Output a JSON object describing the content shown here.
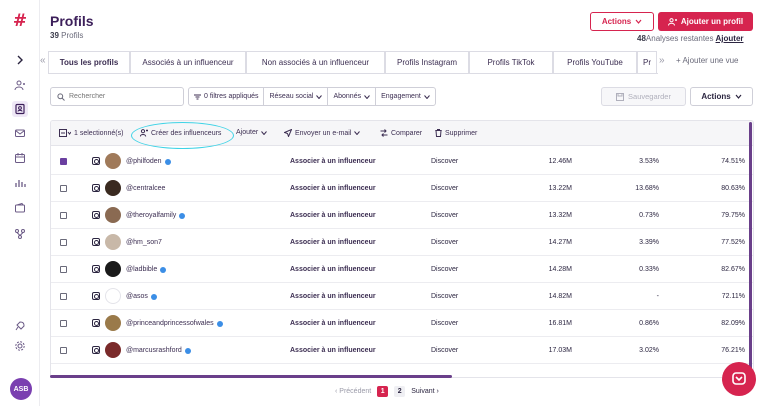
{
  "header": {
    "title": "Profils",
    "profile_count": "39",
    "profile_label": "Profils",
    "actions_label": "Actions",
    "add_label": "Ajouter un profil",
    "remaining_count": "48",
    "remaining_label": "Analyses restantes",
    "add_link": "Ajouter"
  },
  "tabs": [
    {
      "label": "Tous les profils",
      "active": true
    },
    {
      "label": "Associés à un influenceur"
    },
    {
      "label": "Non associés à un influenceur"
    },
    {
      "label": "Profils Instagram"
    },
    {
      "label": "Profils TikTok"
    },
    {
      "label": "Profils YouTube"
    },
    {
      "label": "Pr"
    }
  ],
  "add_view_label": "Ajouter une vue",
  "filters": {
    "search_placeholder": "Rechercher",
    "applied": "0 filtres appliqués",
    "network": "Réseau social",
    "followers": "Abonnés",
    "engagement": "Engagement",
    "save": "Sauvegarder",
    "actions": "Actions"
  },
  "toolbar": {
    "selected": "1 selectionné(s)",
    "create": "Créer des influenceurs",
    "add": "Ajouter",
    "email": "Envoyer un e-mail",
    "compare": "Comparer",
    "delete": "Supprimer"
  },
  "rows": [
    {
      "handle": "@philfoden",
      "verified": true,
      "checked": true,
      "assoc": "Associer à un influenceur",
      "source": "Discover",
      "followers": "12.46M",
      "engagement": "3.53%",
      "last": "74.51%",
      "pic": "#a07a5a"
    },
    {
      "handle": "@centralcee",
      "verified": false,
      "checked": false,
      "assoc": "Associer à un influenceur",
      "source": "Discover",
      "followers": "13.22M",
      "engagement": "13.68%",
      "last": "80.63%",
      "pic": "#3a2a20"
    },
    {
      "handle": "@theroyalfamily",
      "verified": true,
      "checked": false,
      "assoc": "Associer à un influenceur",
      "source": "Discover",
      "followers": "13.32M",
      "engagement": "0.73%",
      "last": "79.75%",
      "pic": "#8a6a52"
    },
    {
      "handle": "@hm_son7",
      "verified": false,
      "checked": false,
      "assoc": "Associer à un influenceur",
      "source": "Discover",
      "followers": "14.27M",
      "engagement": "3.39%",
      "last": "77.52%",
      "pic": "#c8b8a8"
    },
    {
      "handle": "@ladbible",
      "verified": true,
      "checked": false,
      "assoc": "Associer à un influenceur",
      "source": "Discover",
      "followers": "14.28M",
      "engagement": "0.33%",
      "last": "82.67%",
      "pic": "#1a1a1a"
    },
    {
      "handle": "@asos",
      "verified": true,
      "checked": false,
      "assoc": "Associer à un influenceur",
      "source": "Discover",
      "followers": "14.82M",
      "engagement": "-",
      "last": "72.11%",
      "pic": "#ffffff"
    },
    {
      "handle": "@princeandprincessofwales",
      "verified": true,
      "checked": false,
      "assoc": "Associer à un influenceur",
      "source": "Discover",
      "followers": "16.81M",
      "engagement": "0.86%",
      "last": "82.09%",
      "pic": "#9a7a4a"
    },
    {
      "handle": "@marcusrashford",
      "verified": true,
      "checked": false,
      "assoc": "Associer à un influenceur",
      "source": "Discover",
      "followers": "17.03M",
      "engagement": "3.02%",
      "last": "76.21%",
      "pic": "#7a2a2a"
    }
  ],
  "pagination": {
    "prev": "Précédent",
    "current": "1",
    "other": "2",
    "next": "Suivant"
  },
  "avatar_initials": "ASB",
  "colors": {
    "brand": "#d6244f",
    "accent": "#6a3f8a",
    "highlight": "#3fd3e6"
  }
}
